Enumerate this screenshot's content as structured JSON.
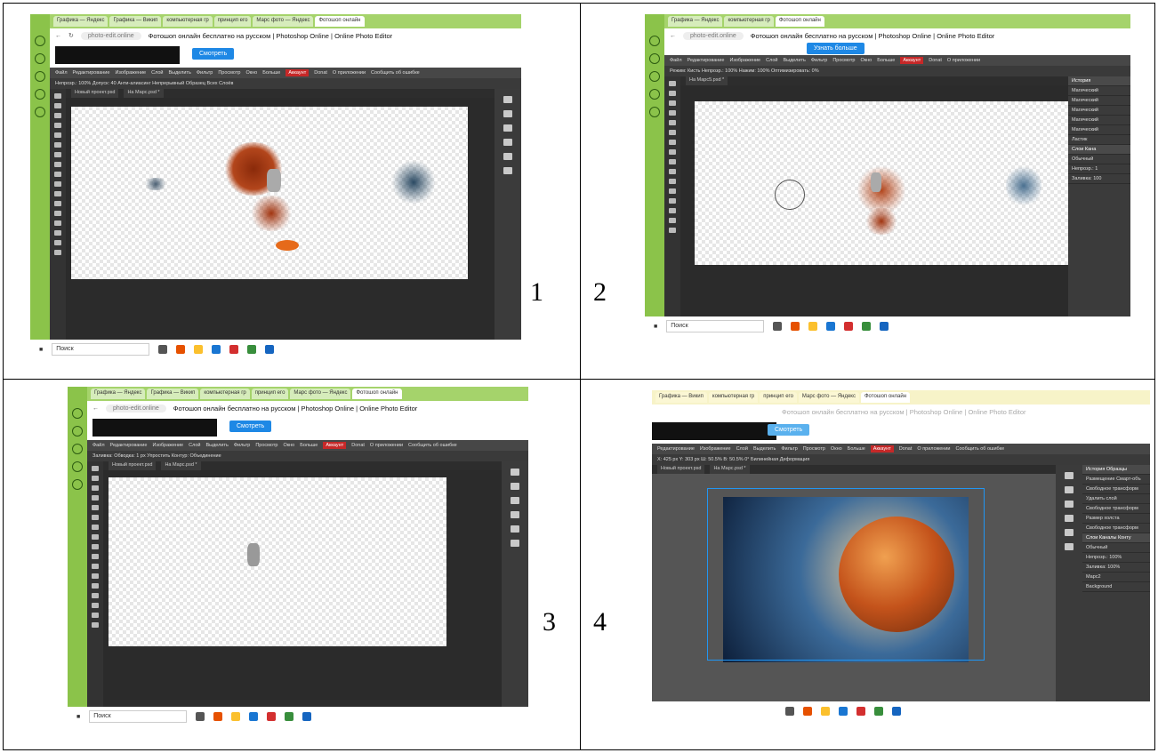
{
  "labels": [
    "1",
    "2",
    "3",
    "4"
  ],
  "browser": {
    "url": "photo-edit.online",
    "title": "Фотошоп онлайн бесплатно на русском | Photoshop Online | Online Photo Editor",
    "ad_button_1": "Смотреть",
    "ad_button_2": "Узнать больше",
    "tabs": [
      "Графика — Яндекс",
      "Графика — Викип",
      "компьютерная гр",
      "принцип его",
      "Марс фото — Яндекс",
      "Фотошоп онлайн"
    ]
  },
  "menu": [
    "Файл",
    "Редактирование",
    "Изображение",
    "Слой",
    "Выделить",
    "Фильтр",
    "Просмотр",
    "Окно",
    "Больше",
    "Аккаунт",
    "Donat",
    "О приложении",
    "Сообщить об ошибке"
  ],
  "options": {
    "s1": "Непрозр.: 100%  Допуск: 40  Анти-алиасинг  Непрерывный  Образец Всех Слоёв",
    "s2": "Режим: Кисть  Непрозр.: 100%  Нажим: 100%  Оптимизировать: 0%",
    "s3": "Заливка:  Обводка:  1 px  Упростить  Контур: Объединение",
    "s4": "X: 425 px  Y: 303 px  Ш: 50.5%  В: 50.5%  0°  Билинейная  Деформация"
  },
  "doc_tabs": {
    "s1": [
      "Новый проект.psd",
      "На Марс.psd *"
    ],
    "s2": [
      "На Марс5.psd *"
    ],
    "s3": [
      "Новый проект.psd",
      "На Марс.psd *"
    ],
    "s4": [
      "Новый проект.psd",
      "На Марс.psd *"
    ]
  },
  "history_s2": [
    "История",
    "Магический",
    "Магический",
    "Магический",
    "Магический",
    "Магический",
    "Ластик",
    "Слои  Кана",
    "Обычный",
    "Непрозр.: 1",
    "Заливка: 100"
  ],
  "history_s4": [
    "История   Образцы",
    "Размещение Смарт-объ",
    "Свободное трансформ",
    "Удалить слой",
    "Свободное трансформ",
    "Размер холста",
    "Свободное трансформ",
    "Слои  Каналы  Конту",
    "Обычный",
    "Непрозр.: 100%",
    "Заливка: 100%",
    "Марс2",
    "Background"
  ],
  "taskbar_search": "Поиск"
}
